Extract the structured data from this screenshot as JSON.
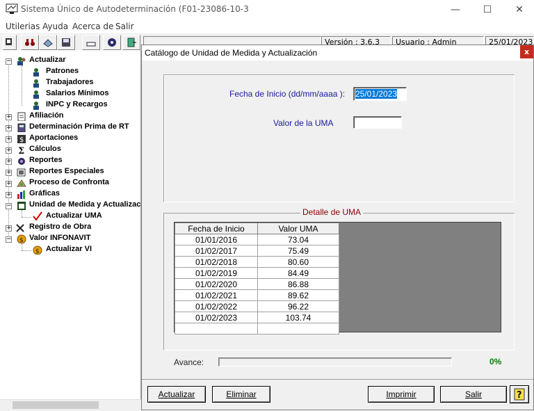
{
  "window": {
    "title": "Sistema Único de Autodeterminación (F01-23086-10-3",
    "minimize": "—",
    "maximize": "☐",
    "close": "✕"
  },
  "menu": [
    "Utilerias",
    "Ayuda",
    "Acerca de",
    "Salir"
  ],
  "status": {
    "version": "Versión : 3.6.3",
    "usuario": "Usuario : Admin",
    "fecha": "25/01/2023"
  },
  "tree": {
    "actualizar": "Actualizar",
    "patrones": "Patrones",
    "trabajadores": "Trabajadores",
    "salarios": "Salarios Mínimos",
    "inpc": "INPC y Recargos",
    "afiliacion": "Afiliación",
    "prima": "Determinación Prima de RT",
    "aportaciones": "Aportaciones",
    "calculos": "Cálculos",
    "reportes": "Reportes",
    "reportes_esp": "Reportes Especiales",
    "confronta": "Proceso de Confronta",
    "graficas": "Gráficas",
    "uma": "Unidad de Medida y Actualizaci",
    "act_uma": "Actualizar UMA",
    "obra": "Registro de Obra",
    "infonavit": "Valor INFONAVIT",
    "act_vi": "Actualizar VI"
  },
  "dialog": {
    "title": "Catálogo de Unidad de Medida y Actualización",
    "close": "x",
    "fecha_label": "Fecha de Inicio (dd/mm/aaaa ):",
    "fecha_value": "25/01/2023",
    "uma_label": "Valor de la UMA",
    "uma_value": "",
    "detalle_label": "Detalle de UMA",
    "col_fecha": "Fecha de Inicio",
    "col_valor": "Valor UMA",
    "rows": [
      {
        "fecha": "01/01/2016",
        "valor": "73.04"
      },
      {
        "fecha": "01/02/2017",
        "valor": "75.49"
      },
      {
        "fecha": "01/02/2018",
        "valor": "80.60"
      },
      {
        "fecha": "01/02/2019",
        "valor": "84.49"
      },
      {
        "fecha": "01/02/2020",
        "valor": "86.88"
      },
      {
        "fecha": "01/02/2021",
        "valor": "89.62"
      },
      {
        "fecha": "01/02/2022",
        "valor": "96.22"
      },
      {
        "fecha": "01/02/2023",
        "valor": "103.74"
      },
      {
        "fecha": "",
        "valor": ""
      }
    ],
    "avance_label": "Avance:",
    "avance_pct": "0%",
    "avance_value": 0,
    "buttons": {
      "actualizar": "Actualizar",
      "eliminar": "Eliminar",
      "imprimir": "Imprimir",
      "salir": "Salir",
      "help": "?"
    }
  },
  "colors": {
    "accent_label": "#1a1a9a",
    "legend": "#8b0000",
    "percent": "#008000",
    "close_red": "#c42b1c",
    "selection": "#0078d7"
  }
}
